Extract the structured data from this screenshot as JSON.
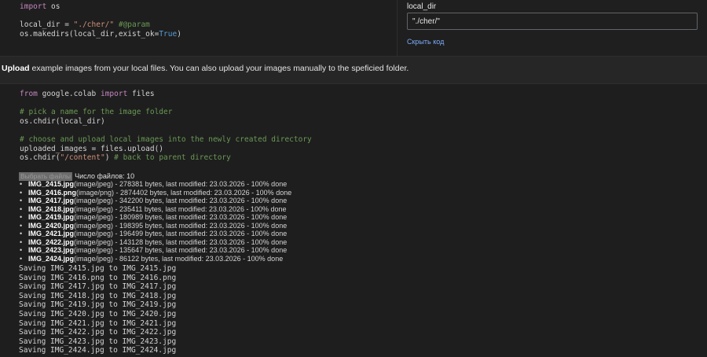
{
  "cell1": {
    "lines": [
      [
        {
          "t": "import",
          "c": "kw"
        },
        {
          "t": " os",
          "c": "plain"
        }
      ],
      [],
      [
        {
          "t": "local_dir = ",
          "c": "plain"
        },
        {
          "t": "\"./cher/\"",
          "c": "str"
        },
        {
          "t": " #@param",
          "c": "com"
        }
      ],
      [
        {
          "t": "os.makedirs(local_dir,exist_ok=",
          "c": "plain"
        },
        {
          "t": "True",
          "c": "bool"
        },
        {
          "t": ")",
          "c": "plain"
        }
      ]
    ]
  },
  "form": {
    "label": "local_dir",
    "value": "\"./cher/\"",
    "hide_code": "Скрыть код"
  },
  "markdown": {
    "bold": "Upload",
    "text": " example images from your local files. You can also upload your images manually to the speficied folder."
  },
  "cell2": {
    "lines": [
      [
        {
          "t": "from",
          "c": "kw"
        },
        {
          "t": " google.colab ",
          "c": "plain"
        },
        {
          "t": "import",
          "c": "kw"
        },
        {
          "t": " files",
          "c": "plain"
        }
      ],
      [],
      [
        {
          "t": "# pick a name for the image folder",
          "c": "com"
        }
      ],
      [
        {
          "t": "os.chdir(local_dir)",
          "c": "plain"
        }
      ],
      [],
      [
        {
          "t": "# choose and upload local images into the newly created directory",
          "c": "com"
        }
      ],
      [
        {
          "t": "uploaded_images = files.upload()",
          "c": "plain"
        }
      ],
      [
        {
          "t": "os.chdir(",
          "c": "plain"
        },
        {
          "t": "\"/content\"",
          "c": "str"
        },
        {
          "t": ") ",
          "c": "plain"
        },
        {
          "t": "# back to parent directory",
          "c": "com"
        }
      ]
    ]
  },
  "output": {
    "choose_files": "Выбрать файлы",
    "file_count": "Число файлов: 10",
    "files": [
      {
        "name": "IMG_2415.jpg",
        "info": "(image/jpeg) - 278381 bytes, last modified: 23.03.2026 - 100% done"
      },
      {
        "name": "IMG_2416.png",
        "info": "(image/png) - 2874402 bytes, last modified: 23.03.2026 - 100% done"
      },
      {
        "name": "IMG_2417.jpg",
        "info": "(image/jpeg) - 342200 bytes, last modified: 23.03.2026 - 100% done"
      },
      {
        "name": "IMG_2418.jpg",
        "info": "(image/jpeg) - 235411 bytes, last modified: 23.03.2026 - 100% done"
      },
      {
        "name": "IMG_2419.jpg",
        "info": "(image/jpeg) - 180989 bytes, last modified: 23.03.2026 - 100% done"
      },
      {
        "name": "IMG_2420.jpg",
        "info": "(image/jpeg) - 198395 bytes, last modified: 23.03.2026 - 100% done"
      },
      {
        "name": "IMG_2421.jpg",
        "info": "(image/jpeg) - 196499 bytes, last modified: 23.03.2026 - 100% done"
      },
      {
        "name": "IMG_2422.jpg",
        "info": "(image/jpeg) - 143128 bytes, last modified: 23.03.2026 - 100% done"
      },
      {
        "name": "IMG_2423.jpg",
        "info": "(image/jpeg) - 135647 bytes, last modified: 23.03.2026 - 100% done"
      },
      {
        "name": "IMG_2424.jpg",
        "info": "(image/jpeg) - 86122 bytes, last modified: 23.03.2026 - 100% done"
      }
    ],
    "saving": [
      "Saving IMG_2415.jpg to IMG_2415.jpg",
      "Saving IMG_2416.png to IMG_2416.png",
      "Saving IMG_2417.jpg to IMG_2417.jpg",
      "Saving IMG_2418.jpg to IMG_2418.jpg",
      "Saving IMG_2419.jpg to IMG_2419.jpg",
      "Saving IMG_2420.jpg to IMG_2420.jpg",
      "Saving IMG_2421.jpg to IMG_2421.jpg",
      "Saving IMG_2422.jpg to IMG_2422.jpg",
      "Saving IMG_2423.jpg to IMG_2423.jpg",
      "Saving IMG_2424.jpg to IMG_2424.jpg"
    ]
  }
}
